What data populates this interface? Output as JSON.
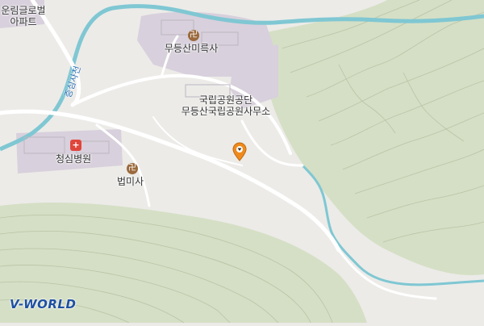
{
  "map": {
    "labels": {
      "apt_line1": "운림글로벌",
      "apt_line2": "아파트",
      "stream": "증심사천",
      "temple_mudeung": "무등산미륵사",
      "park_line1": "국립공원공단",
      "park_line2": "무등산국립공원사무소",
      "hospital": "청심병원",
      "temple_beopmi": "법미사"
    },
    "logo": "V-WORLD",
    "icons": {
      "temple_glyph": "卍",
      "hospital_glyph": "+"
    },
    "colors": {
      "background": "#ecebe8",
      "green_area": "#d5dfc5",
      "facility": "#d8d0dc",
      "stream": "#7fc7d3",
      "road": "#ffffff",
      "pin": "#f08a1c",
      "logo": "#1e4fa3"
    }
  }
}
